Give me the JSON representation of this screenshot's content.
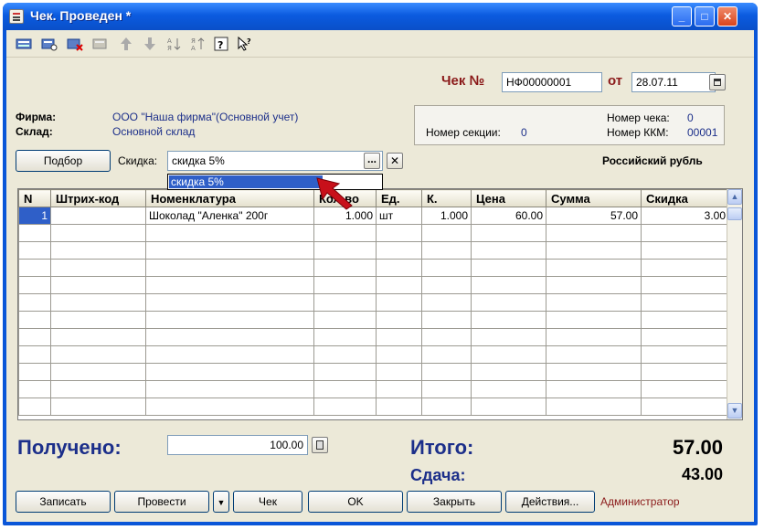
{
  "window": {
    "title": "Чек. Проведен *"
  },
  "header": {
    "doc_label": "Чек №",
    "doc_number": "НФ00000001",
    "date_label": "от",
    "date_value": "28.07.11",
    "firm_label": "Фирма:",
    "firm_value": "ООО \"Наша фирма\"(Основной учет)",
    "warehouse_label": "Склад:",
    "warehouse_value": "Основной склад",
    "section_label": "Номер секции:",
    "section_value": "0",
    "check_num_label": "Номер чека:",
    "check_num_value": "0",
    "kkm_label": "Номер ККМ:",
    "kkm_value": "00001",
    "pick_button": "Подбор",
    "discount_label": "Скидка:",
    "discount_value": "скидка 5%",
    "discount_option": "скидка 5%",
    "currency": "Российский рубль"
  },
  "table": {
    "columns": [
      "N",
      "Штрих-код",
      "Номенклатура",
      "Кол-во",
      "Ед.",
      "К.",
      "Цена",
      "Сумма",
      "Скидка"
    ],
    "rows": [
      [
        "1",
        "",
        "Шоколад \"Аленка\" 200г",
        "1.000",
        "шт",
        "1.000",
        "60.00",
        "57.00",
        "3.00"
      ]
    ]
  },
  "totals": {
    "received_label": "Получено:",
    "received_value": "100.00",
    "total_label": "Итого:",
    "total_value": "57.00",
    "change_label": "Сдача:",
    "change_value": "43.00"
  },
  "footer": {
    "save": "Записать",
    "post": "Провести",
    "check": "Чек",
    "ok": "OK",
    "close": "Закрыть",
    "actions": "Действия...",
    "user": "Администратор"
  },
  "colors": {
    "accent": "#2f5fc8",
    "label_red": "#8b1a1a",
    "link_blue": "#1c2f8a"
  }
}
